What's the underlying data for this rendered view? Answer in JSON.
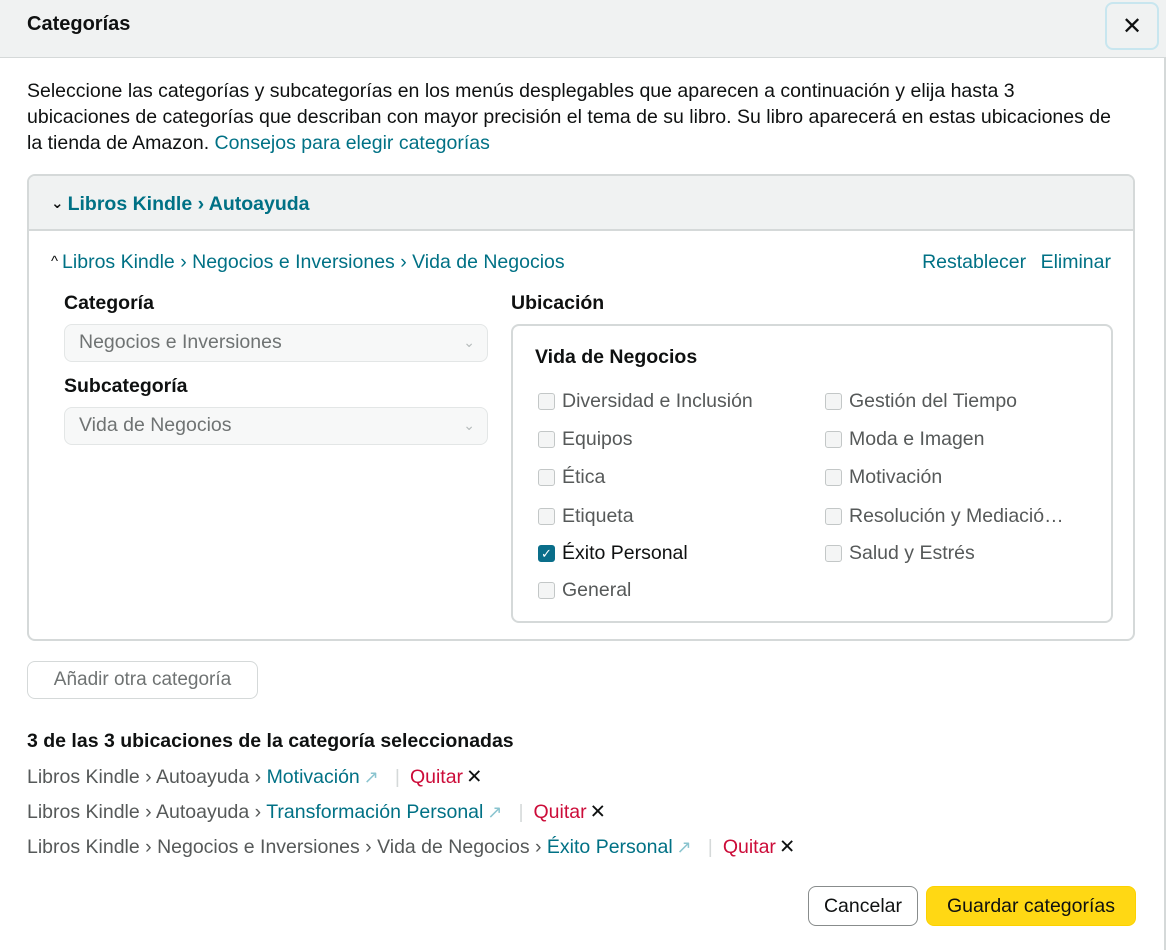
{
  "dialog": {
    "title": "Categorías",
    "close_symbol": "✕"
  },
  "intro": {
    "text": "Seleccione las categorías y subcategorías en los menús desplegables que aparecen a continuación y elija hasta 3 ubicaciones de categorías que describan con mayor precisión el tema de su libro. Su libro aparecerá en estas ubicaciones de la tienda de Amazon. ",
    "link": "Consejos para elegir categorías"
  },
  "collapsed_entry": {
    "label": "Libros Kindle › Autoayuda"
  },
  "expanded_entry": {
    "label": "Libros Kindle › Negocios e Inversiones › Vida de Negocios",
    "reset": "Restablecer",
    "delete": "Eliminar",
    "category_label": "Categoría",
    "category_value": "Negocios e Inversiones",
    "subcategory_label": "Subcategoría",
    "subcategory_value": "Vida de Negocios",
    "location_label": "Ubicación",
    "location_title": "Vida de Negocios",
    "options_left": [
      {
        "label": "Diversidad e Inclusión",
        "checked": false
      },
      {
        "label": "Equipos",
        "checked": false
      },
      {
        "label": "Ética",
        "checked": false
      },
      {
        "label": "Etiqueta",
        "checked": false
      },
      {
        "label": "Éxito Personal",
        "checked": true
      },
      {
        "label": "General",
        "checked": false
      }
    ],
    "options_right": [
      {
        "label": "Gestión del Tiempo",
        "checked": false
      },
      {
        "label": "Moda e Imagen",
        "checked": false
      },
      {
        "label": "Motivación",
        "checked": false
      },
      {
        "label": "Resolución y Mediació…",
        "checked": false
      },
      {
        "label": "Salud y Estrés",
        "checked": false
      }
    ]
  },
  "add_category": "Añadir otra categoría",
  "selected": {
    "title": "3 de las 3 ubicaciones de la categoría seleccionadas",
    "remove_label": "Quitar",
    "items": [
      {
        "path": "Libros Kindle › Autoayuda › ",
        "leaf": "Motivación"
      },
      {
        "path": "Libros Kindle › Autoayuda › ",
        "leaf": "Transformación Personal"
      },
      {
        "path": "Libros Kindle › Negocios e Inversiones › Vida de Negocios › ",
        "leaf": "Éxito Personal"
      }
    ]
  },
  "footer": {
    "cancel": "Cancelar",
    "save": "Guardar categorías"
  },
  "colors": {
    "link": "#007185",
    "remove": "#cc0c39",
    "primary_button": "#ffd814",
    "checkbox_checked": "#0a6e8a"
  },
  "icons": {
    "close": "close-icon",
    "chevron_down": "chevron-down-icon",
    "chevron_up": "chevron-up-icon",
    "external_link": "external-link-icon",
    "checkmark": "checkmark-icon"
  }
}
